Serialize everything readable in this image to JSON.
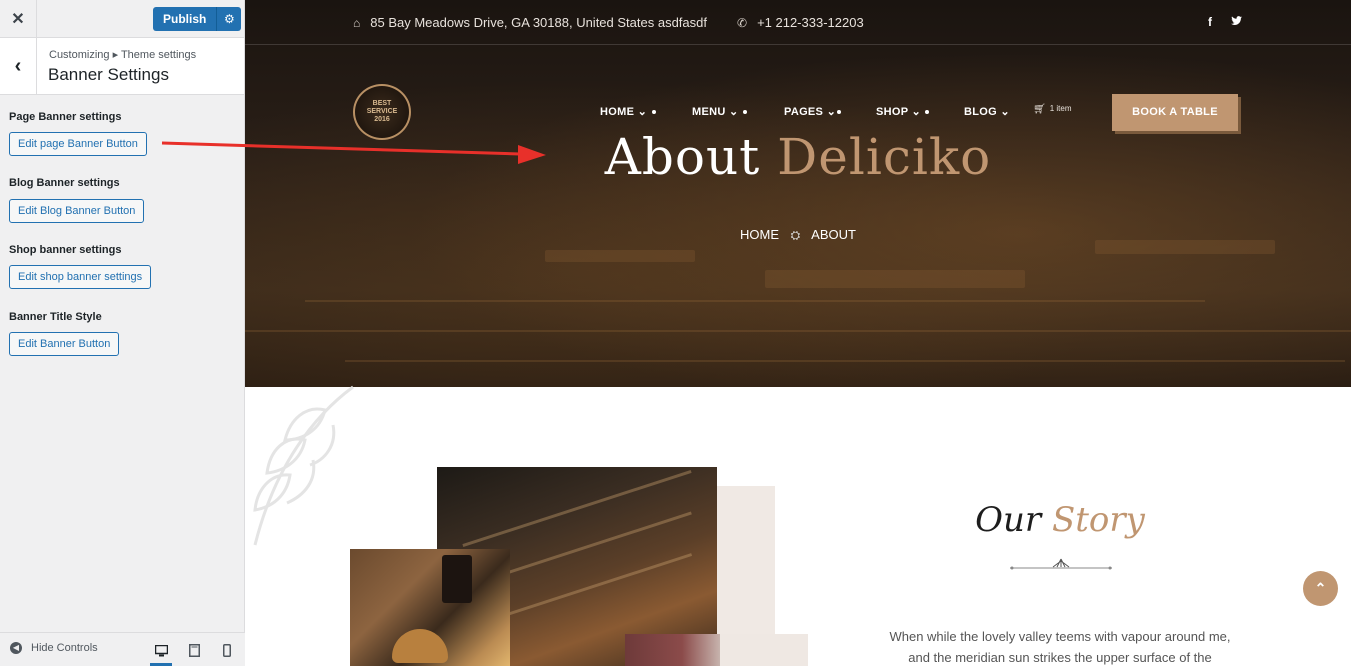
{
  "sidebar": {
    "close_icon": "close-icon",
    "publish_label": "Publish",
    "breadcrumb": "Customizing ▸ Theme settings",
    "title": "Banner Settings",
    "sections": [
      {
        "label": "Page Banner settings",
        "button": "Edit page Banner Button"
      },
      {
        "label": "Blog Banner settings",
        "button": "Edit Blog Banner Button"
      },
      {
        "label": "Shop banner settings",
        "button": "Edit shop banner settings"
      },
      {
        "label": "Banner Title Style",
        "button": "Edit Banner Button"
      }
    ],
    "hide_controls": "Hide Controls",
    "accent_color": "#2271b1"
  },
  "preview": {
    "topbar": {
      "address": "85 Bay Meadows Drive, GA 30188, United States asdfasdf",
      "phone": "+1 212-333-12203",
      "social": [
        "f",
        "t"
      ]
    },
    "logo": {
      "line1": "BEST",
      "line2": "SERVICE",
      "line3": "2016"
    },
    "nav": [
      "HOME",
      "MENU",
      "PAGES",
      "SHOP",
      "BLOG"
    ],
    "cart_label": "1 item",
    "book_button": "BOOK A TABLE",
    "hero": {
      "title_main": "About",
      "title_accent": "Deliciko",
      "crumb_home": "HOME",
      "crumb_current": "ABOUT"
    },
    "story": {
      "title_main": "Our",
      "title_accent": "Story",
      "text_line1": "When while the lovely valley teems with vapour around me,",
      "text_line2": "and the meridian sun strikes the upper surface of the"
    },
    "brand_color": "#c09671",
    "annotation_color": "#e8302a"
  }
}
